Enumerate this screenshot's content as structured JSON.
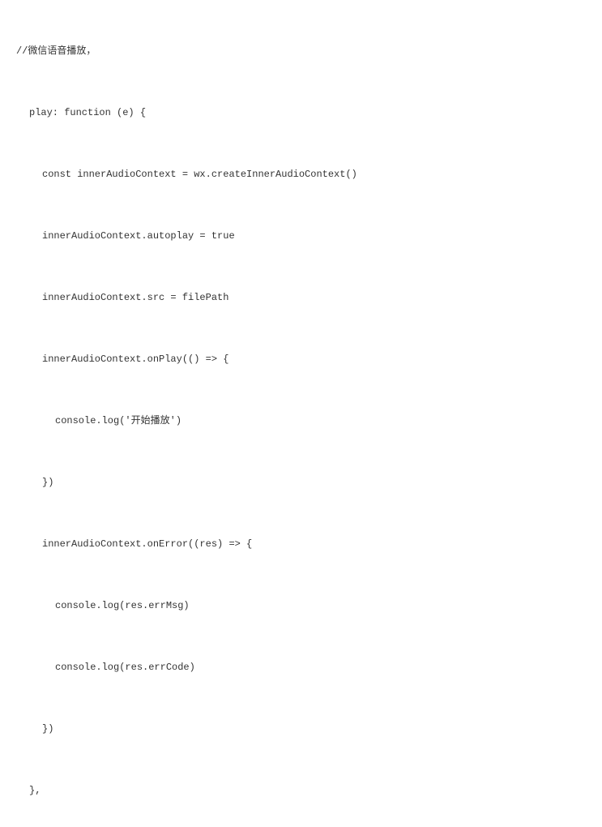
{
  "code": {
    "lines": [
      {
        "text": "//微信语音播放，",
        "indent": 0
      },
      {
        "text": "play: function (e) {",
        "indent": 1
      },
      {
        "text": "const innerAudioContext = wx.createInnerAudioContext()",
        "indent": 2
      },
      {
        "text": "innerAudioContext.autoplay = true",
        "indent": 2
      },
      {
        "text": "innerAudioContext.src = filePath",
        "indent": 2
      },
      {
        "text": "innerAudioContext.onPlay(() => {",
        "indent": 2
      },
      {
        "text": "console.log('开始播放')",
        "indent": 3
      },
      {
        "text": "})",
        "indent": 2
      },
      {
        "text": "innerAudioContext.onError((res) => {",
        "indent": 2
      },
      {
        "text": "console.log(res.errMsg)",
        "indent": 3
      },
      {
        "text": "console.log(res.errCode)",
        "indent": 3
      },
      {
        "text": "})",
        "indent": 2
      },
      {
        "text": "},",
        "indent": 1
      }
    ]
  }
}
